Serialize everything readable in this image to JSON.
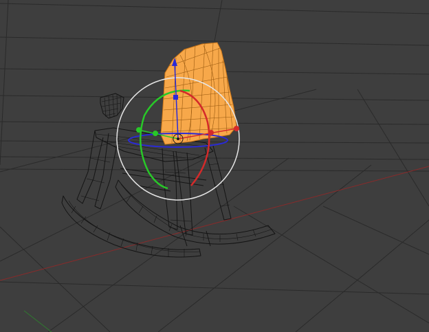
{
  "viewport": {
    "view": "perspective",
    "shading": "wireframe",
    "background_color": "#3e3e3e",
    "grid_color": "#2a2a2a"
  },
  "axes": {
    "x_axis_color": "#8a2a2a",
    "y_axis_color": "#2f7a2f"
  },
  "scene": {
    "object": "rocking-horse",
    "wire_color": "#141414",
    "selected_part": "horse-head",
    "selection_color": "#f7a84a"
  },
  "gizmo": {
    "mode": "rotate",
    "x_color": "#d42a2a",
    "y_color": "#28c828",
    "z_color": "#2a2ad8",
    "screen_ring_color": "#e6e6e6"
  }
}
